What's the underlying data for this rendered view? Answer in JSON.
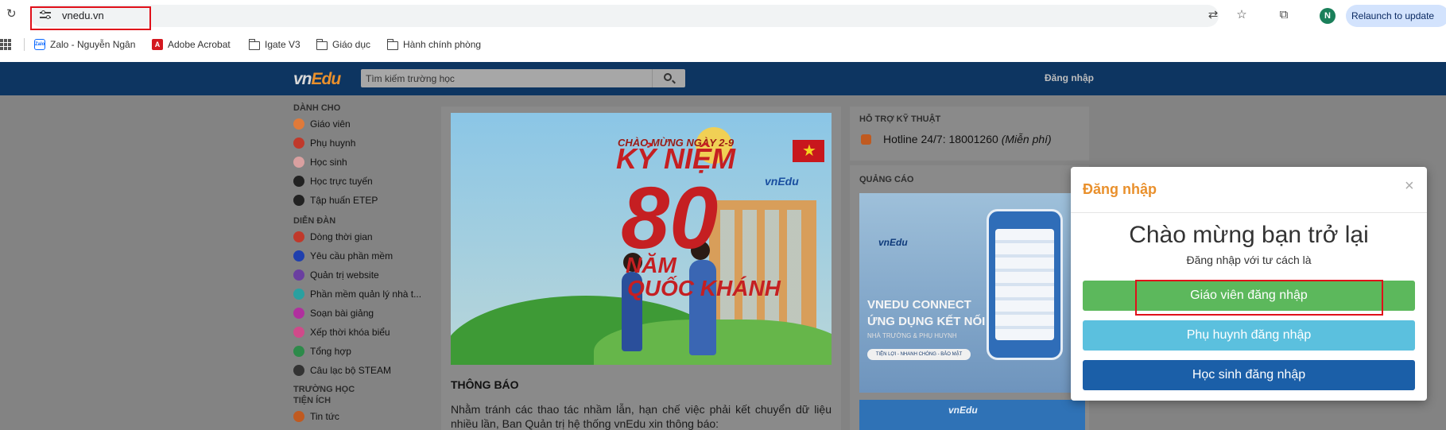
{
  "browser": {
    "url": "vnedu.vn",
    "relaunch_label": "Relaunch to update",
    "profile_initial": "N",
    "bookmarks": [
      {
        "label": "Zalo - Nguyễn Ngân",
        "icon": "zalo-icon"
      },
      {
        "label": "Adobe Acrobat",
        "icon": "acrobat-icon"
      },
      {
        "label": "Igate V3",
        "icon": "folder-icon"
      },
      {
        "label": "Giáo dục",
        "icon": "folder-icon"
      },
      {
        "label": "Hành chính phòng",
        "icon": "folder-icon"
      }
    ]
  },
  "header": {
    "logo_vn": "vn",
    "logo_edu": "Edu",
    "search_placeholder": "Tìm kiếm trường học",
    "login_link": "Đăng nhập"
  },
  "menu": {
    "sections": [
      {
        "title": "DÀNH CHO",
        "items": [
          {
            "label": "Giáo viên",
            "icon": "teacher-icon",
            "color": "#e07a3a"
          },
          {
            "label": "Phụ huynh",
            "icon": "parent-icon",
            "color": "#c0392b"
          },
          {
            "label": "Học sinh",
            "icon": "student-icon",
            "color": "#d9a0a0"
          },
          {
            "label": "Học trực tuyến",
            "icon": "online-learning-icon",
            "color": "#222222"
          },
          {
            "label": "Tập huấn ETEP",
            "icon": "training-icon",
            "color": "#222222"
          }
        ]
      },
      {
        "title": "DIỄN ĐÀN",
        "items": [
          {
            "label": "Dòng thời gian",
            "icon": "timeline-icon",
            "color": "#c0392b"
          },
          {
            "label": "Yêu cầu phần mềm",
            "icon": "bookmark-icon",
            "color": "#1f3fae"
          },
          {
            "label": "Quản trị website",
            "icon": "globe-icon",
            "color": "#6a3fa0"
          },
          {
            "label": "Phần mềm quản lý nhà t...",
            "icon": "graduation-cap-icon",
            "color": "#2aa0a0"
          },
          {
            "label": "Soạn bài giảng",
            "icon": "edit-icon",
            "color": "#b0309e"
          },
          {
            "label": "Xếp thời khóa biểu",
            "icon": "calendar-icon",
            "color": "#d04a8a"
          },
          {
            "label": "Tổng hợp",
            "icon": "plus-square-icon",
            "color": "#2d8a4a"
          },
          {
            "label": "Câu lạc bộ STEAM",
            "icon": "steam-icon",
            "color": "#333333"
          }
        ]
      },
      {
        "title": "TRƯỜNG HỌC",
        "items": []
      },
      {
        "title": "TIỆN ÍCH",
        "items": [
          {
            "label": "Tin tức",
            "icon": "news-icon",
            "color": "#c05a20"
          }
        ]
      }
    ]
  },
  "banner": {
    "small_title": "CHÀO MỪNG NGÀY 2-9",
    "line1": "KỶ NIỆM",
    "number": "80",
    "line2": "NĂM",
    "line3": "QUỐC KHÁNH",
    "brand": "vnEdu"
  },
  "notice": {
    "title": "THÔNG BÁO",
    "text": "Nhằm tránh các thao tác nhầm lẫn, hạn chế việc phải kết chuyển dữ liệu nhiều lần, Ban Quản trị hệ thống vnEdu xin thông báo:"
  },
  "support": {
    "title": "HỖ TRỢ KỸ THUẬT",
    "hotline": "Hotline 24/7: 18001260",
    "free": "(Miễn phí)"
  },
  "ads": {
    "title": "QUẢNG CÁO",
    "ad1_brand": "vnEdu",
    "ad1_line1": "VNEDU CONNECT",
    "ad1_line2": "ỨNG DỤNG KẾT NỐI",
    "ad1_line3": "NHÀ TRƯỜNG & PHỤ HUYNH",
    "ad1_pill": "TIỆN LỢI - NHANH CHÓNG - BẢO MẬT",
    "ad2_brand": "vnEdu"
  },
  "modal": {
    "title": "Đăng nhập",
    "close": "×",
    "welcome": "Chào mừng bạn trở lại",
    "subtitle": "Đăng nhập với tư cách là",
    "btn_teacher": "Giáo viên đăng nhập",
    "btn_parent": "Phụ huynh đăng nhập",
    "btn_student": "Học sinh đăng nhập",
    "colors": {
      "teacher": "#5cb85c",
      "parent": "#5bc0de",
      "student": "#1b5fa8",
      "title": "#e9902c"
    }
  }
}
